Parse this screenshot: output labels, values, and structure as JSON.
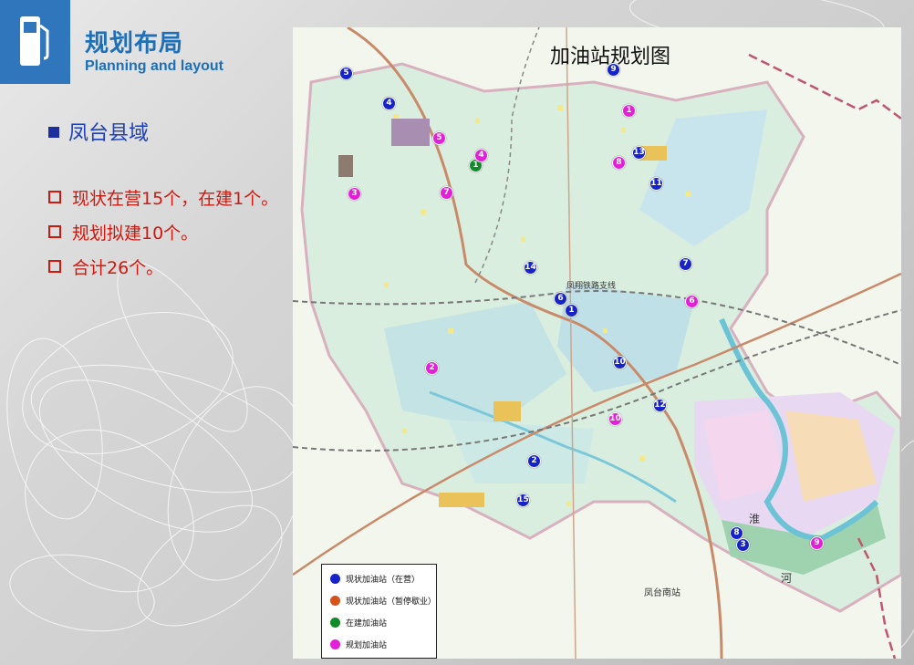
{
  "header": {
    "icon": "gas-pump-icon",
    "title_cn": "规划布局",
    "title_en": "Planning and layout"
  },
  "section": {
    "heading": "凤台县域"
  },
  "bullets": [
    {
      "text": "现状在营15个，在建1个。"
    },
    {
      "text": "规划拟建10个。"
    },
    {
      "text": "合计26个。"
    }
  ],
  "map": {
    "title": "加油站规划图",
    "legend": [
      {
        "label": "现状加油站（在营）",
        "color": "#1623c8"
      },
      {
        "label": "现状加油站（暂停歇业）",
        "color": "#d4541c"
      },
      {
        "label": "在建加油站",
        "color": "#118a2a"
      },
      {
        "label": "规划加油站",
        "color": "#e220d8"
      }
    ],
    "place_labels": {
      "south_station": "凤台南站",
      "railway_branch": "凤翔铁路支线",
      "river": "河",
      "huai": "淮"
    },
    "stations": {
      "existing": [
        "5",
        "9",
        "4",
        "13",
        "11",
        "7",
        "6",
        "1",
        "14",
        "10",
        "12",
        "2",
        "15",
        "8",
        "3"
      ],
      "construction": [
        "1"
      ],
      "planned": [
        "1",
        "5",
        "4",
        "8",
        "3",
        "7",
        "6",
        "2",
        "10",
        "9"
      ]
    }
  }
}
